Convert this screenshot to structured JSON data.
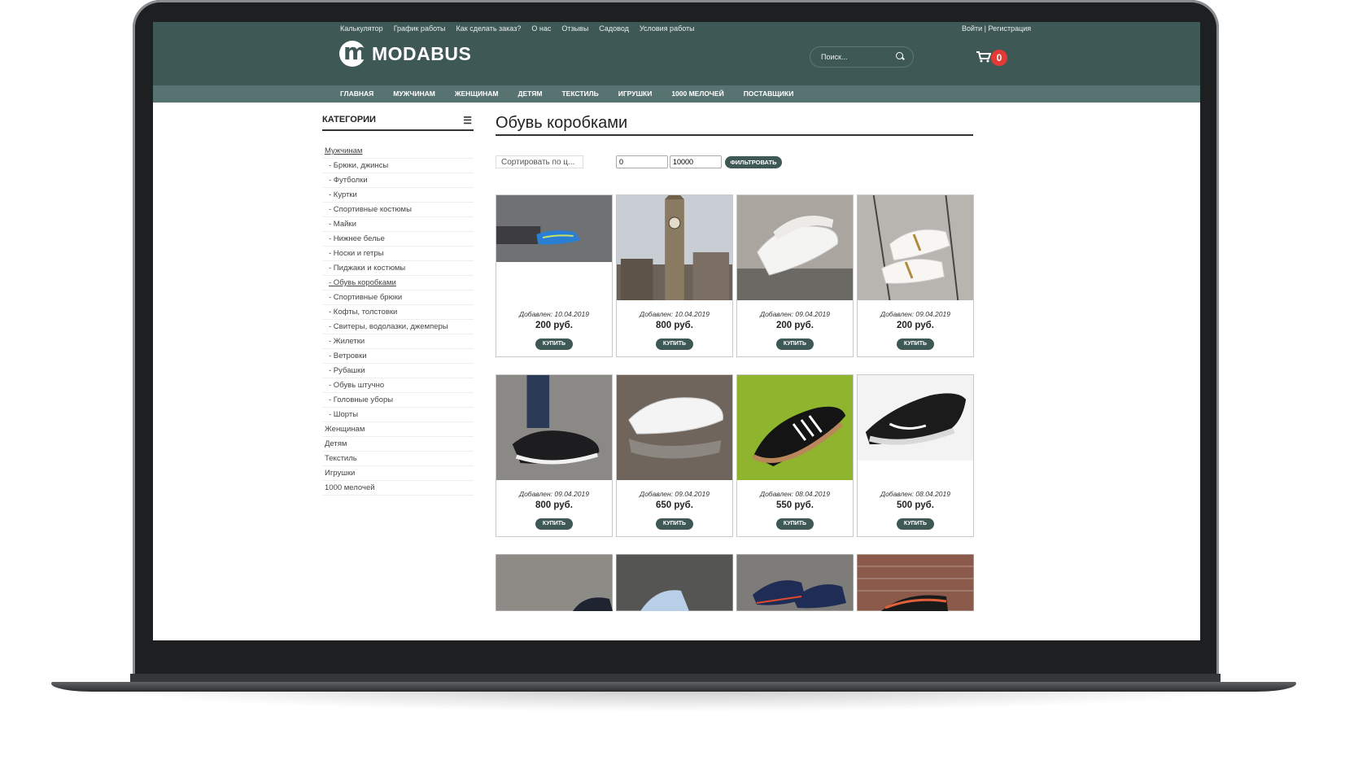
{
  "top_links": [
    "Калькулятор",
    "График работы",
    "Как сделать заказ?",
    "О нас",
    "Отзывы",
    "Садовод",
    "Условия работы"
  ],
  "auth": "Войти | Регистрация",
  "logo": "MODABUS",
  "search": {
    "placeholder": "Поиск..."
  },
  "cart": {
    "count": "0"
  },
  "nav": [
    "ГЛАВНАЯ",
    "МУЖЧИНАМ",
    "ЖЕНЩИНАМ",
    "ДЕТЯМ",
    "ТЕКСТИЛЬ",
    "ИГРУШКИ",
    "1000 МЕЛОЧЕЙ",
    "ПОСТАВЩИКИ"
  ],
  "sidebar": {
    "title": "КАТЕГОРИИ",
    "items": [
      "Мужчинам",
      "- Брюки, джинсы",
      "- Футболки",
      "- Куртки",
      "- Спортивные костюмы",
      "- Майки",
      "- Нижнее белье",
      "- Носки и гетры",
      "- Пиджаки и костюмы",
      "- Обувь коробками",
      "- Спортивные брюки",
      "- Кофты, толстовки",
      "- Свитеры, водолазки, джемперы",
      "- Жилетки",
      "- Ветровки",
      "- Рубашки",
      "- Обувь штучно",
      "- Головные уборы",
      "- Шорты",
      "Женщинам",
      "Детям",
      "Текстиль",
      "Игрушки",
      "1000 мелочей"
    ]
  },
  "main": {
    "title": "Обувь коробками",
    "sort": "Сортировать по ц...",
    "price_min": "0",
    "price_max": "10000",
    "filter_label": "ФИЛЬТРОВАТЬ",
    "buy_label": "КУПИТЬ",
    "products": [
      {
        "date": "Добавлен: 10.04.2019",
        "price": "200 руб."
      },
      {
        "date": "Добавлен: 10.04.2019",
        "price": "800 руб."
      },
      {
        "date": "Добавлен: 09.04.2019",
        "price": "200 руб."
      },
      {
        "date": "Добавлен: 09.04.2019",
        "price": "200 руб."
      },
      {
        "date": "Добавлен: 09.04.2019",
        "price": "800 руб."
      },
      {
        "date": "Добавлен: 09.04.2019",
        "price": "650 руб."
      },
      {
        "date": "Добавлен: 08.04.2019",
        "price": "550 руб."
      },
      {
        "date": "Добавлен: 08.04.2019",
        "price": "500 руб."
      }
    ]
  },
  "colors": {
    "brand": "#3e5856",
    "nav": "#577371",
    "badge": "#e53935"
  }
}
